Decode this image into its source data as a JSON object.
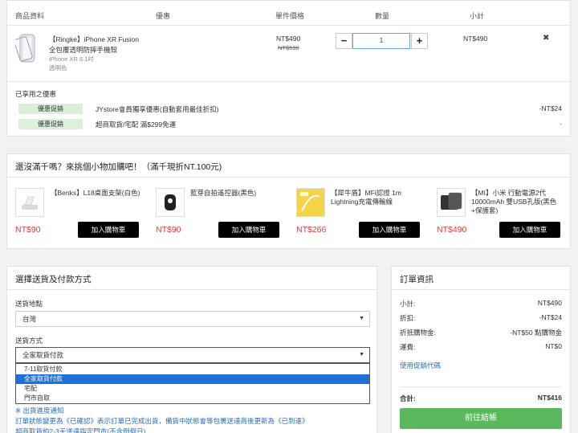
{
  "cart": {
    "columns": {
      "product": "商品資料",
      "discount": "優惠",
      "unit_price": "單件價格",
      "quantity": "數量",
      "subtotal": "小計"
    },
    "item": {
      "name_line1": "【Ringke】iPhone XR Fusion",
      "name_line2": "全包覆透明防摔手機殼",
      "model": "iPhone XR 6.1吋",
      "color": "透明色",
      "price": "NT$490",
      "original_price": "NT$590",
      "qty": "1",
      "minus": "−",
      "plus": "+",
      "subtotal": "NT$490",
      "remove": "✖"
    },
    "applied_title": "已享用之優惠",
    "promos": [
      {
        "badge": "優惠促銷",
        "text": "JYstore會員獨享優惠(自動套用最佳折扣)",
        "amount": "-NT$24"
      },
      {
        "badge": "優惠促銷",
        "text": "超商取貨/宅配 滿$299免運",
        "amount": "-"
      }
    ]
  },
  "addon": {
    "title": "還沒滿千嗎？來挑個小物加購吧！（滿千現折NT.100元)",
    "button_label": "加入購物車",
    "items": [
      {
        "name": "【Benks】L18桌面支架(白色)",
        "price": "NT$90"
      },
      {
        "name": "藍芽自拍遙控器(黑色)",
        "price": "NT$90"
      },
      {
        "name": "【犀牛盾】MFi認證 1m Lightning充電傳輸線",
        "price": "NT$266"
      },
      {
        "name": "【MI】小米 行動電源2代 10000mAh 雙USB孔版(黑色+保護套)",
        "price": "NT$490"
      }
    ]
  },
  "shipping": {
    "title": "選擇送貨及付款方式",
    "region_label": "送貨地點",
    "region_value": "台灣",
    "method_label": "送貨方式",
    "method_value": "全家取貨付款",
    "options": [
      "7-11取貨付款",
      "全家取貨付款",
      "宅配",
      "門市自取"
    ],
    "selected_index": 1,
    "notice_title": "※ 出貨進度通知",
    "notice_line1": "訂單狀態變更為《已確認》表示訂單已完成出貨，備貨中狀態會等包裹送達商後更新為《已到達》",
    "notice_line2": "超商取貨約2-3天送達指定門市(不含例假日)"
  },
  "summary": {
    "title": "訂單資訊",
    "rows": [
      {
        "label": "小計:",
        "value": "NT$490"
      },
      {
        "label": "折扣:",
        "value": "-NT$24"
      },
      {
        "label": "折抵購物金:",
        "value": "-NT$50 點購物金"
      },
      {
        "label": "運費:",
        "value": "NT$0"
      }
    ],
    "promo_link": "使用促銷代碼",
    "total_label": "合計:",
    "total_value": "NT$416",
    "checkout": "前往結帳"
  },
  "colors": {
    "accent_red": "#e4393c",
    "checkout_green": "#5cb85c",
    "badge_green": "#dcefdc",
    "select_highlight": "#1e6fd9"
  }
}
